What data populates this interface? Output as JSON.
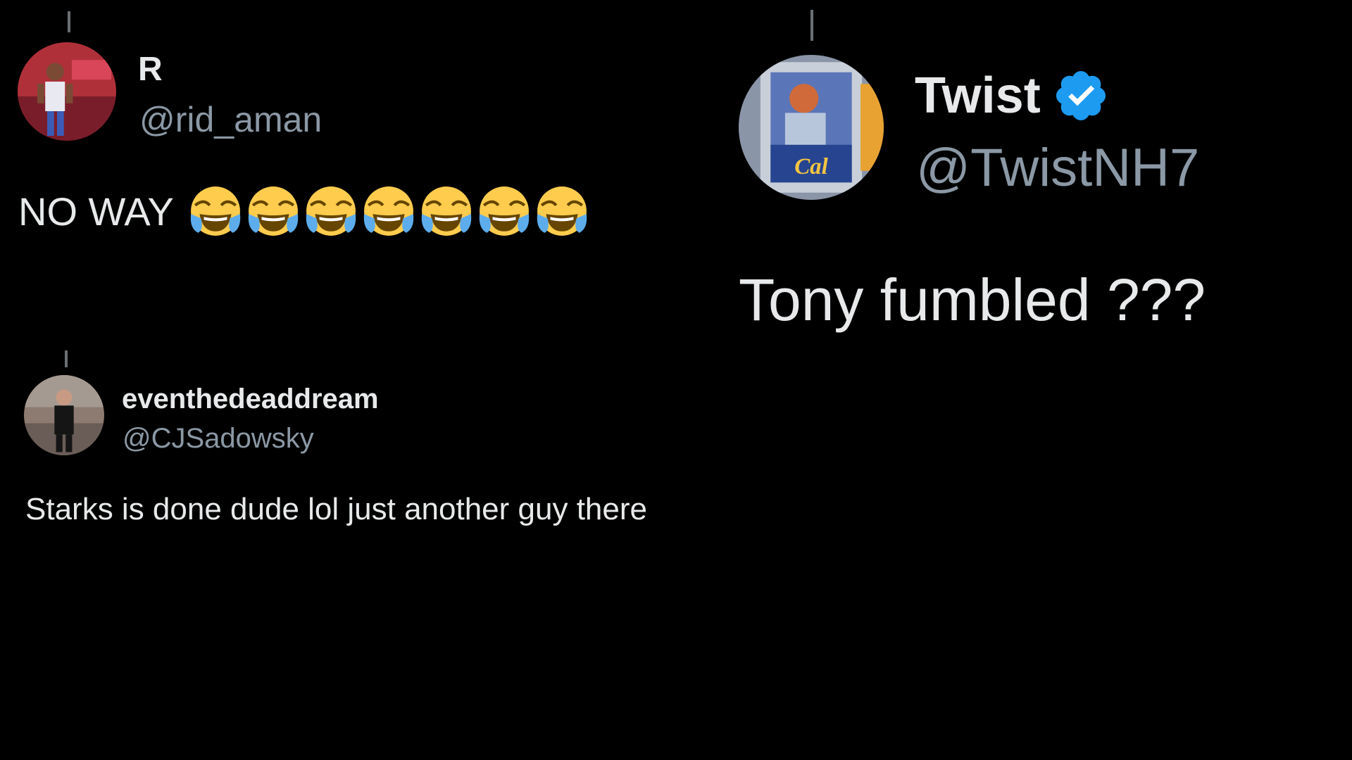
{
  "tweets": [
    {
      "display_name": "R",
      "handle": "@rid_aman",
      "text": "NO WAY",
      "emoji": [
        "tears-of-joy",
        "tears-of-joy",
        "tears-of-joy",
        "tears-of-joy",
        "tears-of-joy",
        "tears-of-joy",
        "tears-of-joy"
      ]
    },
    {
      "display_name": "Twist",
      "handle": "@TwistNH7",
      "verified": true,
      "text": "Tony fumbled ???"
    },
    {
      "display_name": "eventhedeaddream",
      "handle": "@CJSadowsky",
      "text": "Starks is done dude lol just another guy there"
    }
  ],
  "colors": {
    "background": "#000000",
    "primary_text": "#e7e9ea",
    "secondary_text": "#8b98a5",
    "verified_blue": "#1d9bf0",
    "emoji_yellow": "#ffcc4d",
    "tear_blue": "#5dadec"
  }
}
